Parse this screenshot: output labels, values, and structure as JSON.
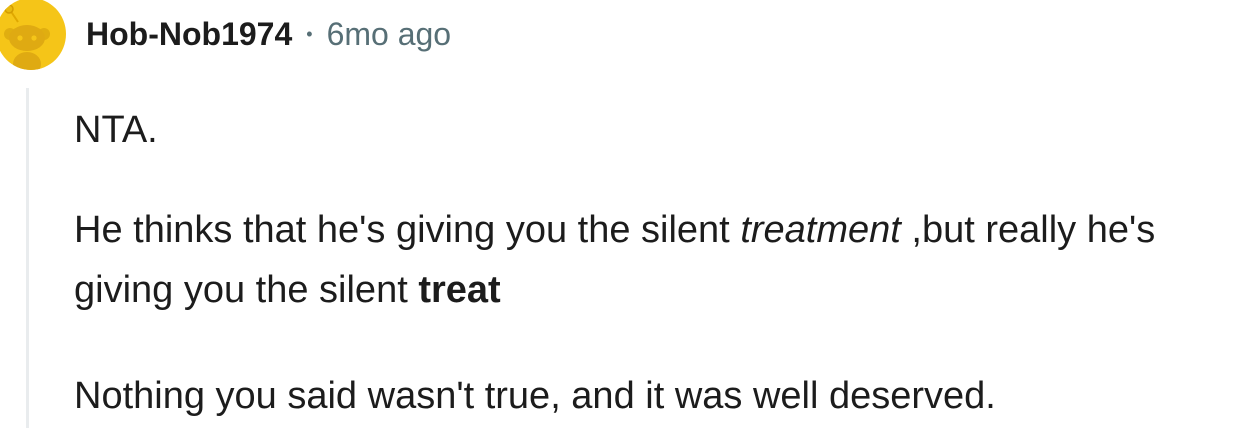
{
  "comment": {
    "username": "Hob-Nob1974",
    "separator": "•",
    "timestamp": "6mo ago",
    "avatar_icon": "snoo-avatar-icon",
    "avatar_color": "#f5c518",
    "paragraphs": {
      "p1": "NTA.",
      "p2": {
        "part1": "He thinks that he's giving you the silent ",
        "italic": "treatment",
        "part2": " ,but really he's giving you the silent ",
        "bold": "treat"
      },
      "p3": "Nothing you said wasn't true, and it was well deserved."
    }
  }
}
